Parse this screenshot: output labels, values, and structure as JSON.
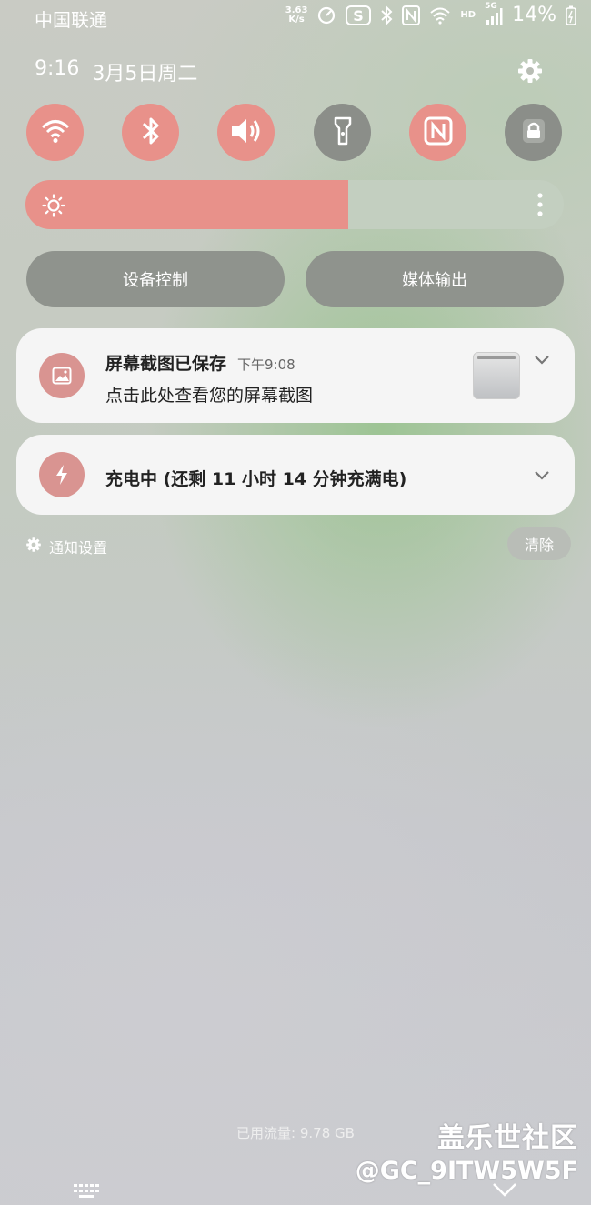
{
  "status_bar": {
    "carrier": "中国联通",
    "net_speed_value": "3.63",
    "net_speed_unit": "K/s",
    "hd_label": "HD",
    "network_type": "5G",
    "battery_percent": "14%",
    "icons": [
      "speed-gauge-icon",
      "s-app-icon",
      "bluetooth-icon",
      "nfc-icon",
      "wifi-icon",
      "signal-icon",
      "battery-icon"
    ]
  },
  "header": {
    "time": "9:16",
    "date": "3月5日周二"
  },
  "quick_settings": [
    {
      "name": "wifi",
      "state": "on"
    },
    {
      "name": "bluetooth",
      "state": "on"
    },
    {
      "name": "sound",
      "state": "on"
    },
    {
      "name": "flashlight",
      "state": "off"
    },
    {
      "name": "nfc",
      "state": "on"
    },
    {
      "name": "screen-lock",
      "state": "off"
    }
  ],
  "brightness": {
    "level": 0.6
  },
  "buttons": {
    "device_control": "设备控制",
    "media_output": "媒体输出"
  },
  "notifications": [
    {
      "title": "屏幕截图已保存",
      "time": "下午9:08",
      "body": "点击此处查看您的屏幕截图"
    },
    {
      "title": "充电中 (还剩 11 小时 14 分钟充满电)"
    }
  ],
  "footer": {
    "notification_settings": "通知设置",
    "clear": "清除",
    "data_used": "已用流量: 9.78 GB"
  },
  "watermark": {
    "line1": "盖乐世社区",
    "line2": "@GC_9ITW5W5F"
  },
  "colors": {
    "accent": "#e8918a",
    "off_toggle": "#8b8e89",
    "card": "#f5f5f5"
  }
}
